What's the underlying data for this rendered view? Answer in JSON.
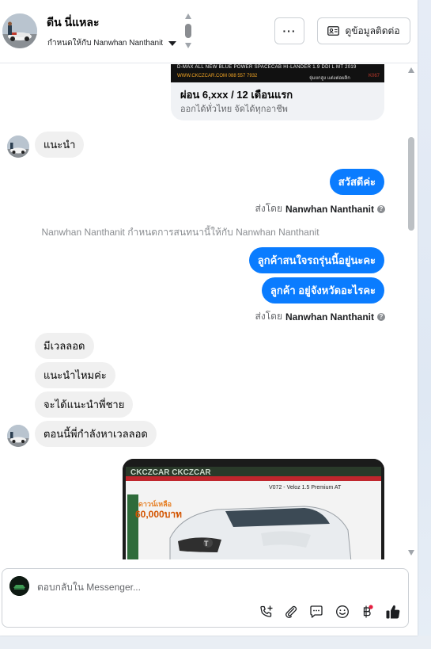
{
  "header": {
    "contact_name": "ดีน นี่แหละ",
    "assigned_text": "กำหนดให้กับ Nanwhan Nanthanit",
    "more_label": "···",
    "contact_info_label": "ดูข้อมูลติดต่อ"
  },
  "ad": {
    "strip_line1": "D-MAX ALL NEW BLUE POWER SPACECAB HI-LANDER 1.9 DDI L MT 2019",
    "strip_line2": "WWW.CKCZCAR.COM 088 557 7932",
    "strip_line3": "จุ่มยกสูง แต่งต่อผลิก",
    "strip_code": "K067",
    "title": "ผ่อน 6,xxx  / 12 เดือนแรก",
    "subtitle": "ออกได้ทั่วไทย จัดได้ทุกอาชีพ"
  },
  "messages": {
    "in_1": "แนะนำ",
    "out_1": "สวัสดีค่ะ",
    "sent_by_prefix": "ส่งโดย",
    "sent_by_name": "Nanwhan Nanthanit",
    "system_assign": "Nanwhan Nanthanit กำหนดการสนทนานี้ให้กับ Nanwhan Nanthanit",
    "out_2": "ลูกค้าสนใจรถรุ่นนี้อยู่นะคะ",
    "out_3": "ลูกค้า อยู่จังหวัดอะไรคะ",
    "in_2": "มีเวลลอด",
    "in_3": "แนะนำไหมค่ะ",
    "in_4": "จะได้แนะนำพี่ชาย",
    "in_5": "ตอนนี้พี่กำลังหาเวลลอด"
  },
  "photo": {
    "top_text": "CKCZCAR CKCZCAR",
    "model": "V072 - Veloz 1.5 Premium AT",
    "promo_line1": "ดาวน์เหลือ",
    "promo_line2": "60,000บาท"
  },
  "composer": {
    "placeholder": "ตอบกลับใน Messenger...",
    "tools": [
      "call-add-icon",
      "attachment-icon",
      "saved-reply-icon",
      "emoji-icon",
      "payment-baht-icon",
      "like-icon"
    ]
  },
  "colors": {
    "outgoing_bubble": "#0a7cff",
    "incoming_bubble": "#f0f0f0",
    "notification_dot": "#e41e3f"
  }
}
